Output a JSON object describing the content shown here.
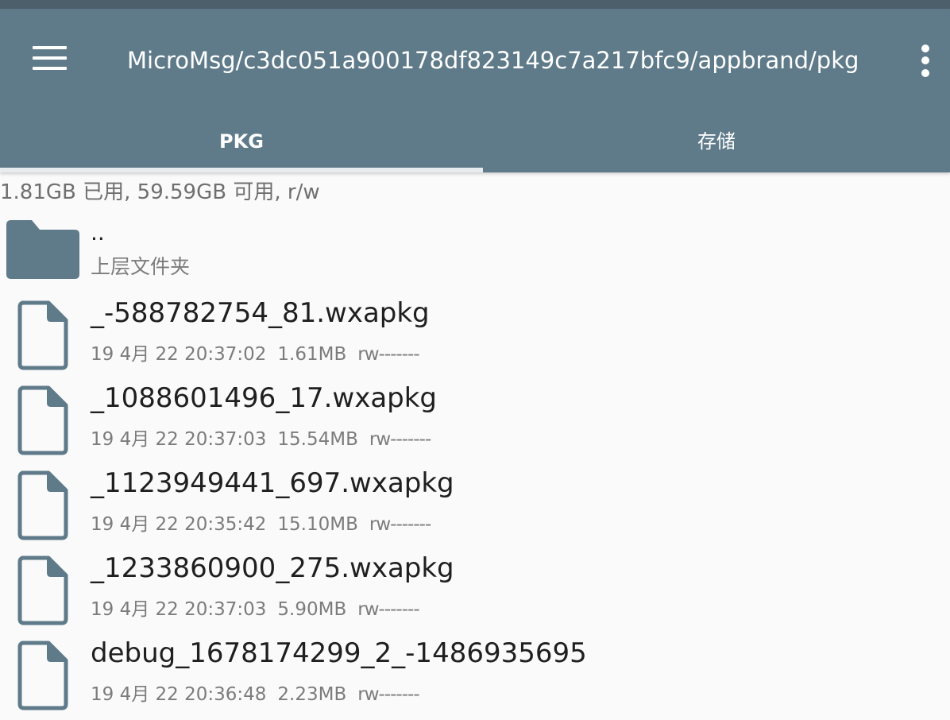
{
  "appbar": {
    "path": "MicroMsg/c3dc051a900178df823149c7a217bfc9/appbrand/pkg",
    "menu_icon": "hamburger-menu-icon",
    "overflow_icon": "more-vert-icon",
    "color": "#5f7b8a"
  },
  "tabs": [
    {
      "label": "PKG",
      "active": true
    },
    {
      "label": "存储",
      "active": false
    }
  ],
  "storage_info": "1.81GB 已用, 59.59GB 可用, r/w",
  "parent": {
    "name": "..",
    "subtitle": "上层文件夹",
    "icon": "folder-icon"
  },
  "files": [
    {
      "name": "_-588782754_81.wxapkg",
      "date": "19 4月 22 20:37:02",
      "size": "1.61MB",
      "perms": "rw-------",
      "icon": "file-icon"
    },
    {
      "name": "_1088601496_17.wxapkg",
      "date": "19 4月 22 20:37:03",
      "size": "15.54MB",
      "perms": "rw-------",
      "icon": "file-icon"
    },
    {
      "name": "_1123949441_697.wxapkg",
      "date": "19 4月 22 20:35:42",
      "size": "15.10MB",
      "perms": "rw-------",
      "icon": "file-icon"
    },
    {
      "name": "_1233860900_275.wxapkg",
      "date": "19 4月 22 20:37:03",
      "size": "5.90MB",
      "perms": "rw-------",
      "icon": "file-icon"
    },
    {
      "name": "debug_1678174299_2_-1486935695",
      "date": "19 4月 22 20:36:48",
      "size": "2.23MB",
      "perms": "rw-------",
      "icon": "file-icon"
    }
  ]
}
